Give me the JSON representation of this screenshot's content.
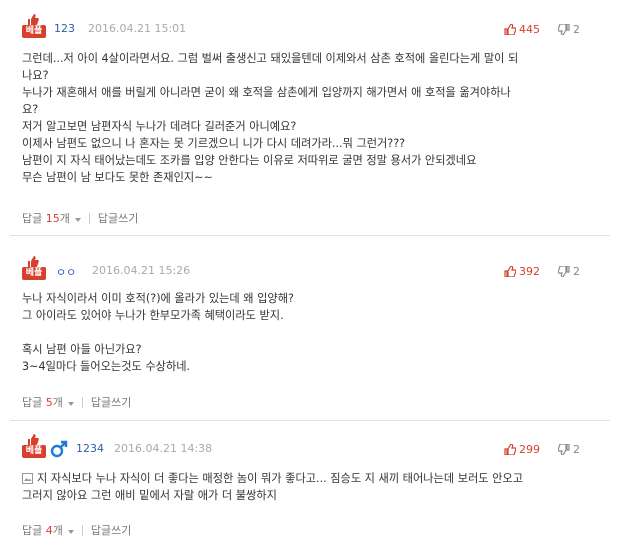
{
  "badge_label": "베플",
  "colors": {
    "accent": "#d6402d",
    "author": "#2d5fa8",
    "muted": "#aaaaaa",
    "gender_male": "#1e7bd6"
  },
  "labels": {
    "reply": "답글",
    "write_reply": "답글쓰기",
    "reply_count_suffix": "개"
  },
  "comments": [
    {
      "author": "123",
      "date": "2016.04.21 15:01",
      "up": "445",
      "down": "2",
      "reply_count": "15",
      "lines": [
        "그런데...저 아이 4살이라면서요. 그럼 벌써 출생신고 돼있을텐데 이제와서 삼촌 호적에 올린다는게 말이 되",
        "나요?",
        "누나가 재혼해서 애를 버릴게 아니라면 굳이 왜 호적을 삼촌에게 입양까지 해가면서 애 호적을 옮겨야하나",
        "요?",
        "저거 알고보면 남편자식 누나가 데려다 길러준거 아니예요?",
        "이제사 남편도 없으니 나 혼자는 못 기르겠으니 니가 다시 데려가라...뭐 그런거???",
        "남편이 지 자식 태어났는데도 조카를 입양 안한다는 이유로 저따위로 굴면 정말 용서가 안되겠네요",
        "무슨 남편이 남 보다도 못한 존재인지~~"
      ]
    },
    {
      "author": "ㅇㅇ",
      "date": "2016.04.21 15:26",
      "up": "392",
      "down": "2",
      "reply_count": "5",
      "lines": [
        "누나 자식이라서 이미 호적(?)에 올라가 있는데 왜 입양해?",
        "그 아이라도 있어야 누나가 한부모가족 혜택이라도 받지.",
        "",
        "혹시 남편 아들 아닌가요?",
        "3~4일마다 들어오는것도 수상하네."
      ]
    },
    {
      "author": "1234",
      "gender_icon": "male-icon",
      "date": "2016.04.21 14:38",
      "up": "299",
      "down": "2",
      "reply_count": "4",
      "lines": [
        "지 자식보다 누나 자식이 더 좋다는 매정한 놈이 뭐가 좋다고... 짐승도 지 새끼 태어나는데 보러도 안오고",
        "그러지 않아요 그런 애비 밑에서 자랄 애가 더 불쌍하지"
      ]
    }
  ]
}
